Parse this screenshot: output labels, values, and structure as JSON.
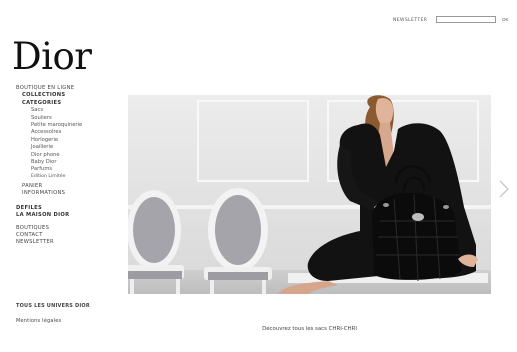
{
  "header": {
    "newsletter_label": "NEWSLETTER",
    "newsletter_value": "",
    "ok_label": "OK"
  },
  "logo": "Dior",
  "nav": {
    "boutique": "BOUTIQUE EN LIGNE",
    "collections": "COLLECTIONS",
    "categories": "CATEGORIES",
    "category_items": [
      "Sacs",
      "Souliers",
      "Petite maroquinerie",
      "Accessoires",
      "Horlogerie",
      "Joaillerie",
      "Dior phone",
      "Baby Dior",
      "Parfums"
    ],
    "edition": "Edition Limitée",
    "panier": "PANIER",
    "informations": "INFORMATIONS",
    "defiles": "DEFILES",
    "maison": "LA MAISON DIOR",
    "boutiques": "BOUTIQUES",
    "contact": "CONTACT",
    "newsletter": "NEWSLETTER"
  },
  "footer": {
    "univers": "TOUS LES UNIVERS DIOR",
    "mentions": "Mentions légales"
  },
  "caption": "Découvrez tous les sacs CHRI-CHRI",
  "colors": {
    "background": "#ffffff",
    "text": "#333333",
    "dress": "#111111",
    "wall": "#e6e6e6",
    "chair_seat": "#9a9aa0"
  }
}
